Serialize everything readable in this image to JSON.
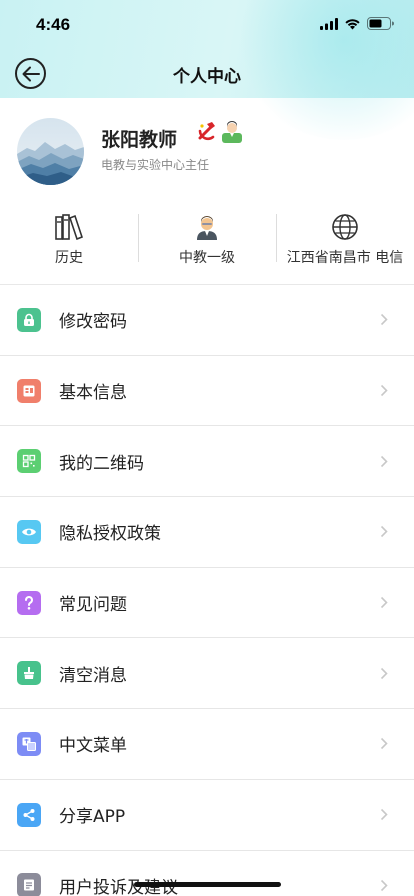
{
  "status_bar": {
    "time": "4:46"
  },
  "nav": {
    "title": "个人中心"
  },
  "profile": {
    "name": "张阳教师",
    "title": "电教与实验中心主任"
  },
  "stats": [
    {
      "label": "历史",
      "icon": "books-icon"
    },
    {
      "label": "中教一级",
      "icon": "teacher-icon"
    },
    {
      "label": "江西省南昌市 电信",
      "icon": "globe-icon"
    }
  ],
  "menu": [
    {
      "label": "修改密码",
      "icon": "lock-icon",
      "color": "#4cc28f"
    },
    {
      "label": "基本信息",
      "icon": "profile-card-icon",
      "color": "#f07f6b"
    },
    {
      "label": "我的二维码",
      "icon": "qr-code-icon",
      "color": "#5ccf72"
    },
    {
      "label": "隐私授权政策",
      "icon": "eye-icon",
      "color": "#57c8f2"
    },
    {
      "label": "常见问题",
      "icon": "question-icon",
      "color": "#b56df0"
    },
    {
      "label": "清空消息",
      "icon": "broom-icon",
      "color": "#47c28c"
    },
    {
      "label": "中文菜单",
      "icon": "translate-icon",
      "color": "#7d8cf5"
    },
    {
      "label": "分享APP",
      "icon": "share-icon",
      "color": "#4aa6f5"
    },
    {
      "label": "用户投诉及建议",
      "icon": "feedback-icon",
      "color": "#8c8c9a"
    }
  ]
}
